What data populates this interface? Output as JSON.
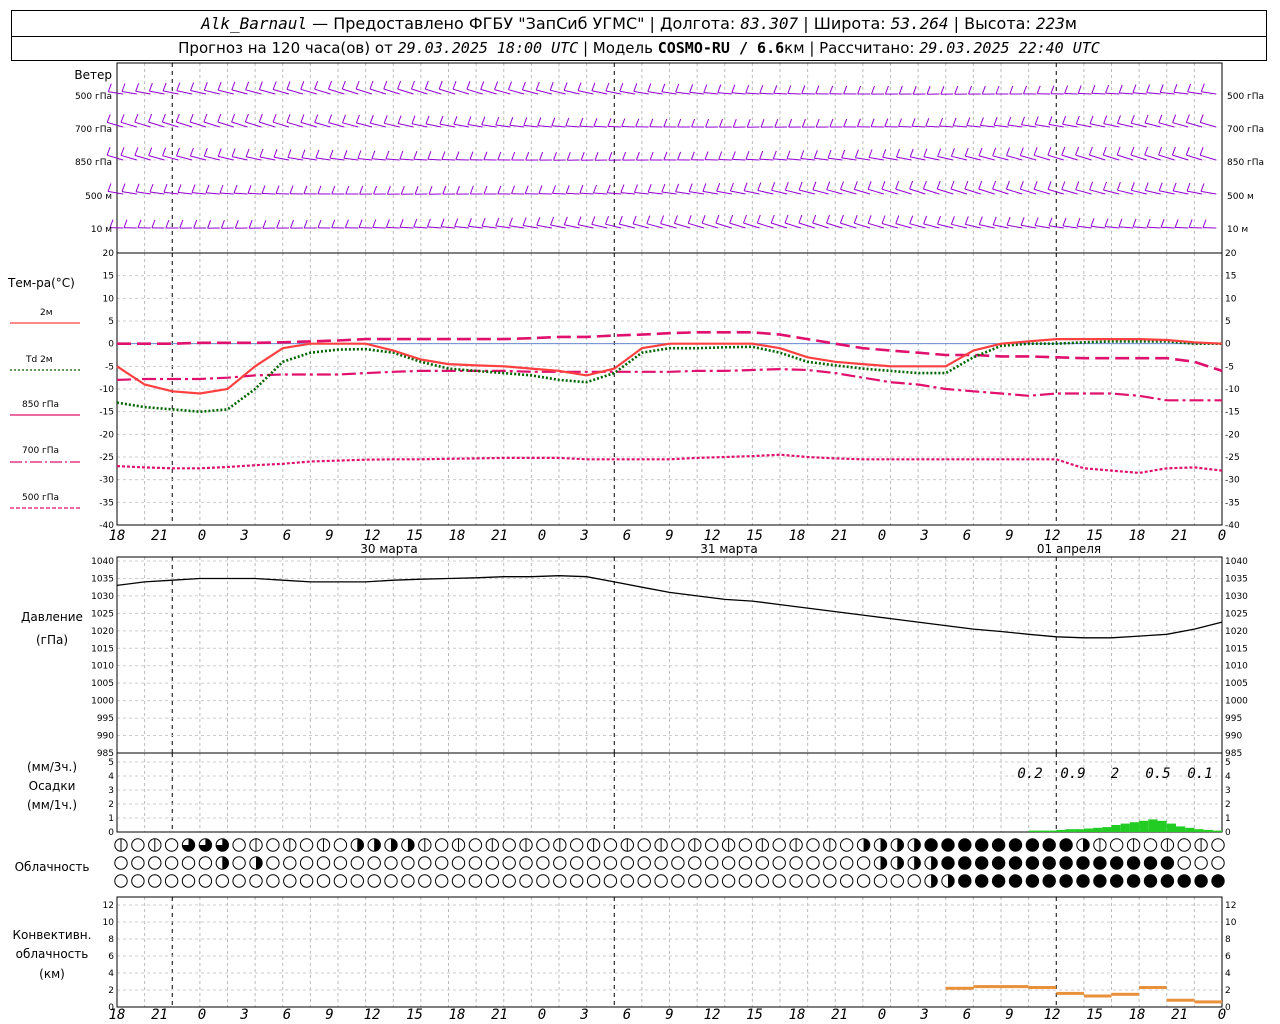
{
  "header": {
    "station": "Alk_Barnaul",
    "provider": " — Предоставлено ФГБУ \"ЗапСиб УГМС\" | Долгота: ",
    "lon": "83.307",
    "lat_label": " | Широта: ",
    "lat": "53.264",
    "alt_label": " | Высота: ",
    "alt": "223",
    "alt_unit": "м",
    "forecast_label": "Прогноз на 120 часа(ов) от ",
    "forecast_from": "29.03.2025 18:00 UTC",
    "model_label": "  | Модель ",
    "model": "COSMO-RU / 6.6",
    "model_unit": "км",
    "calc_label": " | Рассчитано: ",
    "calc_time": "29.03.2025 22:40 UTC"
  },
  "wind_panel": {
    "title": "Ветер",
    "levels": [
      "500 гПа",
      "700 гПа",
      "850 гПа",
      "500 м",
      "10  м"
    ],
    "color": "#9400d3"
  },
  "temp_panel": {
    "title": "Тем-ра(°C)",
    "legend": [
      {
        "label": "2м",
        "color": "#ff4040",
        "dash": "solid"
      },
      {
        "label": "Td  2м",
        "color": "#006400",
        "dash": "dotted"
      },
      {
        "label": "850 гПа",
        "color": "#e0106e",
        "dash": "dashdot"
      },
      {
        "label": "700 гПа",
        "color": "#e0106e",
        "dash": "dashed"
      },
      {
        "label": "500 гПа",
        "color": "#e0106e",
        "dash": "fine"
      }
    ],
    "y_ticks": [
      "20",
      "15",
      "10",
      "5",
      "0",
      "-5",
      "-10",
      "-15",
      "-20",
      "-25",
      "-30",
      "-35",
      "-40"
    ]
  },
  "time_axis": {
    "tick_labels": [
      "18",
      "21",
      "0",
      "3",
      "6",
      "9",
      "12",
      "15",
      "18",
      "21",
      "0",
      "3",
      "6",
      "9",
      "12",
      "15",
      "18",
      "21",
      "0",
      "3",
      "6",
      "9",
      "12",
      "15",
      "18",
      "21",
      "0"
    ],
    "dates": [
      "30 марта",
      "31 марта",
      "01 апреля"
    ]
  },
  "pressure_panel": {
    "title1": "Давление",
    "title2": "(гПа)",
    "y_ticks": [
      "1040",
      "1035",
      "1030",
      "1025",
      "1020",
      "1015",
      "1010",
      "1005",
      "1000",
      "995",
      "990",
      "985"
    ]
  },
  "precip_panel": {
    "title1": "(мм/3ч.)",
    "title2": "Осадки",
    "title3": "(мм/1ч.)",
    "y_ticks": [
      "5",
      "4",
      "3",
      "2",
      "1",
      "0"
    ],
    "accum_labels": [
      "0.2",
      "0.9",
      "2",
      "0.5",
      "0.1"
    ],
    "color": "#22cc22"
  },
  "cloud_panel": {
    "title": "Облачность"
  },
  "conv_panel": {
    "title1": "Конвективн.",
    "title2": "облачность",
    "title3": "(км)",
    "y_ticks": [
      "12",
      "10",
      "8",
      "6",
      "4",
      "2",
      "0"
    ],
    "color": "#e8913a"
  },
  "chart_data": [
    {
      "type": "line",
      "title": "Тем-ра(°C)",
      "ylim": [
        -40,
        20
      ],
      "x_hours": [
        0,
        3,
        6,
        9,
        12,
        15,
        18,
        21,
        24,
        27,
        30,
        33,
        36,
        39,
        42,
        45,
        48,
        51,
        54,
        57,
        60,
        63,
        66,
        69,
        72,
        75,
        78,
        81,
        84,
        87,
        90,
        93,
        96,
        99,
        102,
        105,
        108,
        111,
        114,
        117,
        120
      ],
      "series": [
        {
          "name": "2м",
          "values": [
            -5,
            -9,
            -10.5,
            -11,
            -10,
            -5,
            -1,
            0,
            0,
            0,
            -1.5,
            -3.5,
            -4.5,
            -4.8,
            -5,
            -5.5,
            -6,
            -7,
            -5.5,
            -1,
            0,
            0,
            0,
            0,
            -1,
            -3,
            -4,
            -4.5,
            -5,
            -5,
            -5,
            -1.5,
            0,
            0.5,
            1,
            1,
            1,
            1,
            0.8,
            0.3,
            0
          ]
        },
        {
          "name": "Td  2м",
          "values": [
            -13,
            -14,
            -14.5,
            -15,
            -14.5,
            -10,
            -4,
            -2,
            -1.3,
            -1.2,
            -2,
            -4,
            -5.5,
            -6,
            -6.5,
            -7,
            -8,
            -8.5,
            -6.5,
            -2,
            -1,
            -1,
            -0.8,
            -0.7,
            -2,
            -4,
            -4.8,
            -5.5,
            -6,
            -6.5,
            -6.5,
            -3,
            -0.5,
            0,
            0,
            0.3,
            0.5,
            0.5,
            0.5,
            0,
            0
          ]
        },
        {
          "name": "850 гПа",
          "values": [
            -8,
            -7.8,
            -7.8,
            -7.8,
            -7.5,
            -7,
            -6.8,
            -6.8,
            -6.8,
            -6.5,
            -6.2,
            -6,
            -6,
            -6,
            -6,
            -6.2,
            -6.2,
            -6.2,
            -6.2,
            -6.2,
            -6.2,
            -6,
            -6,
            -5.8,
            -5.6,
            -5.8,
            -6.5,
            -7.5,
            -8.5,
            -9,
            -10,
            -10.5,
            -11,
            -11.5,
            -11,
            -11,
            -11,
            -11.5,
            -12.5,
            -12.5,
            -12.5
          ]
        },
        {
          "name": "700 гПа",
          "values": [
            0,
            0,
            0,
            0.2,
            0.2,
            0.2,
            0.3,
            0.5,
            0.7,
            1,
            1,
            1,
            1,
            1,
            1,
            1.2,
            1.5,
            1.5,
            1.8,
            2,
            2.3,
            2.5,
            2.5,
            2.5,
            2,
            1,
            0,
            -1,
            -1.5,
            -2,
            -2.5,
            -2.5,
            -2.8,
            -2.8,
            -3,
            -3.2,
            -3.2,
            -3.2,
            -3.2,
            -4,
            -6
          ]
        },
        {
          "name": "500 гПа",
          "values": [
            -27,
            -27.3,
            -27.5,
            -27.5,
            -27.2,
            -26.8,
            -26.5,
            -26,
            -25.8,
            -25.6,
            -25.5,
            -25.5,
            -25.4,
            -25.3,
            -25.2,
            -25.2,
            -25.2,
            -25.5,
            -25.5,
            -25.5,
            -25.5,
            -25.2,
            -25,
            -24.8,
            -24.5,
            -25,
            -25.3,
            -25.5,
            -25.5,
            -25.5,
            -25.5,
            -25.5,
            -25.5,
            -25.5,
            -25.5,
            -27.5,
            -28,
            -28.5,
            -27.5,
            -27.3,
            -28
          ]
        }
      ]
    },
    {
      "type": "line",
      "title": "Давление",
      "ylim": [
        985,
        1040
      ],
      "x_hours": [
        0,
        3,
        6,
        9,
        12,
        15,
        18,
        21,
        24,
        27,
        30,
        33,
        36,
        39,
        42,
        45,
        48,
        51,
        54,
        57,
        60,
        63,
        66,
        69,
        72,
        75,
        78,
        81,
        84,
        87,
        90,
        93,
        96,
        99,
        102,
        105,
        108,
        111,
        114,
        117,
        120
      ],
      "values": [
        1033,
        1034,
        1034.5,
        1035,
        1035,
        1035,
        1034.5,
        1034,
        1034,
        1034,
        1034.5,
        1034.8,
        1035,
        1035.2,
        1035.5,
        1035.5,
        1035.8,
        1035.5,
        1034,
        1032.5,
        1031,
        1030,
        1029,
        1028.5,
        1027.5,
        1026.5,
        1025.5,
        1024.5,
        1023.5,
        1022.5,
        1021.5,
        1020.5,
        1019.8,
        1019,
        1018.3,
        1018,
        1018,
        1018.5,
        1019,
        1020.5,
        1022.5
      ]
    },
    {
      "type": "bar",
      "title": "Осадки",
      "ylim": [
        0,
        5
      ],
      "x_hours": [
        100,
        101,
        102,
        103,
        104,
        105,
        106,
        107,
        108,
        109,
        110,
        111,
        112,
        113,
        114,
        115,
        116,
        117,
        118,
        119,
        120
      ],
      "values": [
        0.1,
        0.1,
        0.1,
        0.15,
        0.2,
        0.2,
        0.25,
        0.3,
        0.35,
        0.5,
        0.6,
        0.7,
        0.8,
        0.9,
        0.8,
        0.6,
        0.4,
        0.3,
        0.2,
        0.15,
        0.1
      ]
    },
    {
      "type": "bar",
      "title": "Конвективн. облачность",
      "ylim": [
        0,
        13
      ],
      "x_hours": [
        93,
        96,
        99,
        102,
        105,
        108,
        111,
        114,
        117,
        120
      ],
      "values": [
        2.2,
        2.4,
        2.4,
        2.3,
        1.6,
        1.3,
        1.5,
        2.3,
        0.8,
        0.6
      ]
    }
  ]
}
